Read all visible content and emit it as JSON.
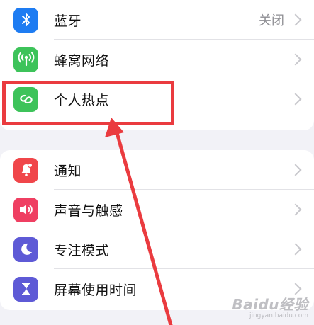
{
  "settings": {
    "group1": [
      {
        "label": "蓝牙",
        "value": "关闭",
        "icon": "bluetooth-icon",
        "color": "#1e7cf2"
      },
      {
        "label": "蜂窝网络",
        "icon": "cellular-antenna-icon",
        "color": "#3dc35a"
      },
      {
        "label": "个人热点",
        "icon": "personal-hotspot-icon",
        "color": "#3dc35a"
      }
    ],
    "group2": [
      {
        "label": "通知",
        "icon": "notification-bell-icon",
        "color": "#f0464a"
      },
      {
        "label": "声音与触感",
        "icon": "speaker-icon",
        "color": "#ef3f62"
      },
      {
        "label": "专注模式",
        "icon": "moon-icon",
        "color": "#5e5ad6"
      },
      {
        "label": "屏幕使用时间",
        "icon": "hourglass-icon",
        "color": "#5e5ad6"
      }
    ]
  },
  "annotation": {
    "highlight_color": "#ea3b3f",
    "target": "个人热点"
  },
  "watermark": {
    "brand": "Baidu经验",
    "site": "jingyan.baidu.com"
  }
}
